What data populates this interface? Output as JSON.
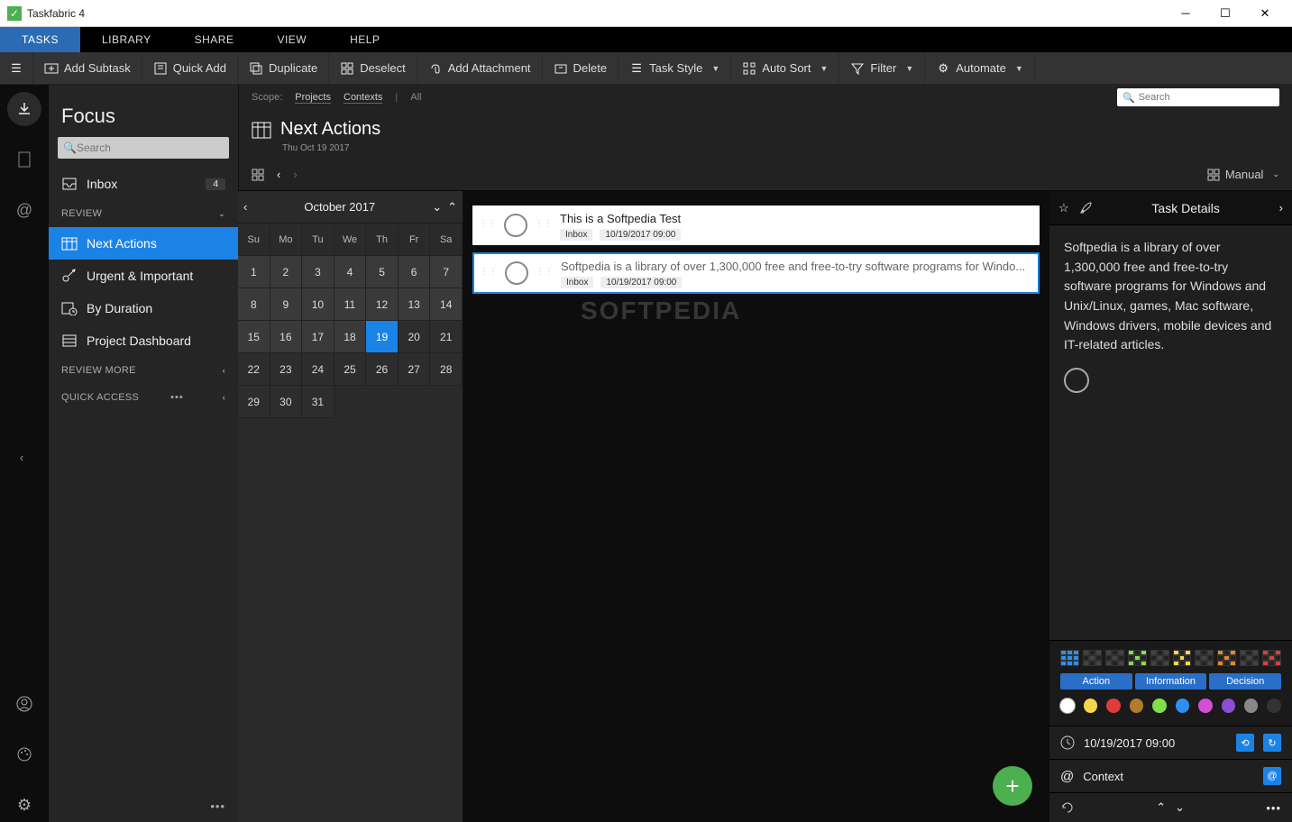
{
  "app": {
    "title": "Taskfabric 4"
  },
  "menu": {
    "tasks": "TASKS",
    "library": "LIBRARY",
    "share": "SHARE",
    "view": "VIEW",
    "help": "HELP"
  },
  "toolbar": {
    "addSubtask": "Add Subtask",
    "quickAdd": "Quick Add",
    "duplicate": "Duplicate",
    "deselect": "Deselect",
    "addAttachment": "Add Attachment",
    "delete": "Delete",
    "taskStyle": "Task Style",
    "autoSort": "Auto Sort",
    "filter": "Filter",
    "automate": "Automate"
  },
  "sidebar": {
    "heading": "Focus",
    "searchPlaceholder": "Search",
    "inbox": {
      "label": "Inbox",
      "badge": "4"
    },
    "sections": {
      "review": "REVIEW",
      "reviewMore": "REVIEW MORE",
      "quickAccess": "QUICK ACCESS"
    },
    "items": {
      "nextActions": "Next Actions",
      "urgent": "Urgent & Important",
      "byDuration": "By Duration",
      "projectDashboard": "Project Dashboard"
    }
  },
  "scope": {
    "label": "Scope:",
    "projects": "Projects",
    "contexts": "Contexts",
    "all": "All",
    "searchPlaceholder": "Search"
  },
  "header": {
    "title": "Next Actions",
    "date": "Thu Oct 19 2017",
    "manual": "Manual"
  },
  "calendar": {
    "month": "October 2017",
    "dow": [
      "Su",
      "Mo",
      "Tu",
      "We",
      "Th",
      "Fr",
      "Sa"
    ],
    "weeks": [
      [
        1,
        2,
        3,
        4,
        5,
        6,
        7
      ],
      [
        8,
        9,
        10,
        11,
        12,
        13,
        14
      ],
      [
        15,
        16,
        17,
        18,
        19,
        20,
        21
      ],
      [
        22,
        23,
        24,
        25,
        26,
        27,
        28
      ],
      [
        29,
        30,
        31
      ]
    ],
    "today": 19
  },
  "tasks": [
    {
      "title": "This is a Softpedia Test",
      "location": "Inbox",
      "date": "10/19/2017 09:00",
      "selected": false
    },
    {
      "title": "Softpedia is a library of over 1,300,000 free and free-to-try software programs for Windo...",
      "location": "Inbox",
      "date": "10/19/2017 09:00",
      "selected": true
    }
  ],
  "details": {
    "title": "Task Details",
    "description": "Softpedia is a library of over 1,300,000 free and free-to-try software programs for Windows and Unix/Linux, games, Mac software, Windows drivers, mobile devices and IT-related articles.",
    "segments": {
      "action": "Action",
      "info": "Information",
      "decision": "Decision"
    },
    "colorSwatches": [
      "#ffffff",
      "#f2d94b",
      "#e03c3c",
      "#b57b2a",
      "#7fe04a",
      "#2e8ff0",
      "#d24fd2",
      "#8a4fd2",
      "#888888",
      "#333333"
    ],
    "due": "10/19/2017 09:00",
    "context": "Context"
  },
  "watermark": "SOFTPEDIA"
}
